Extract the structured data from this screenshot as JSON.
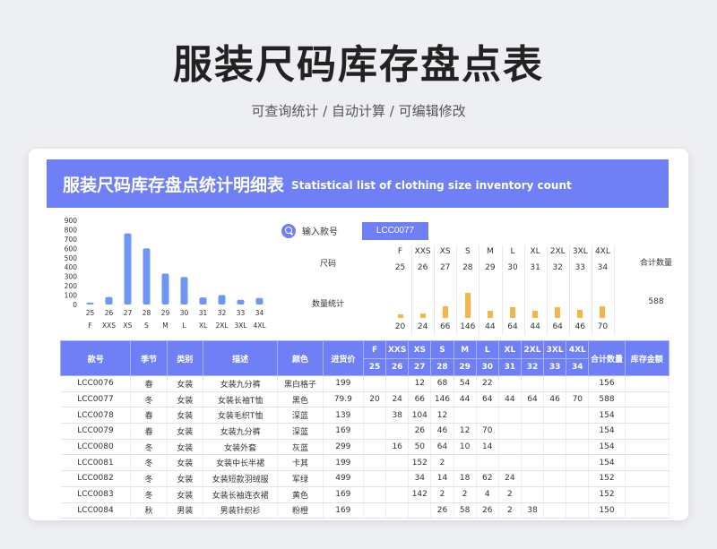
{
  "header": {
    "title": "服装尺码库存盘点表",
    "subtitle": "可查询统计 /  自动计算  /  可编辑修改"
  },
  "banner": {
    "title_cn": "服装尺码库存盘点统计明细表",
    "title_en": "Statistical list of clothing size inventory count"
  },
  "colors": {
    "accent": "#6f7ff5",
    "bar_blue": "#6f95f5",
    "bar_orange": "#f5b648"
  },
  "chart_data": {
    "type": "bar",
    "categories": [
      "F",
      "XXS",
      "XS",
      "S",
      "M",
      "L",
      "XL",
      "2XL",
      "3XL",
      "4XL"
    ],
    "x_numbers": [
      "25",
      "26",
      "27",
      "28",
      "29",
      "30",
      "31",
      "32",
      "33",
      "34"
    ],
    "values": [
      20,
      80,
      760,
      600,
      330,
      295,
      75,
      100,
      50,
      70
    ],
    "ylim": [
      0,
      900
    ],
    "yticks": [
      "900",
      "800",
      "700",
      "600",
      "500",
      "400",
      "300",
      "200",
      "100",
      "0"
    ],
    "grid": false,
    "legend": false
  },
  "search": {
    "label": "输入款号",
    "value": "LCC0077"
  },
  "summary": {
    "size_label": "尺码",
    "count_label": "数量统计",
    "total_label": "合计数量",
    "total_value": "588",
    "sizes": [
      "F",
      "XXS",
      "XS",
      "S",
      "M",
      "L",
      "XL",
      "2XL",
      "3XL",
      "4XL"
    ],
    "numbers": [
      "25",
      "26",
      "27",
      "28",
      "29",
      "30",
      "31",
      "32",
      "33",
      "34"
    ],
    "counts": [
      "20",
      "24",
      "66",
      "146",
      "44",
      "64",
      "44",
      "64",
      "46",
      "70"
    ],
    "count_values": [
      20,
      24,
      66,
      146,
      44,
      64,
      44,
      64,
      46,
      70
    ]
  },
  "table": {
    "headers": [
      "款号",
      "季节",
      "类别",
      "描述",
      "颜色",
      "进货价"
    ],
    "sizes": [
      "F",
      "XXS",
      "XS",
      "S",
      "M",
      "L",
      "XL",
      "2XL",
      "3XL",
      "4XL"
    ],
    "numbers": [
      "25",
      "26",
      "27",
      "28",
      "29",
      "30",
      "31",
      "32",
      "33",
      "34"
    ],
    "total_header": "合计数量",
    "amount_header": "库存金额",
    "rows": [
      {
        "id": "LCC0076",
        "season": "春",
        "category": "女装",
        "desc": "女装九分裤",
        "color": "黑白格子",
        "price": "199",
        "qty": [
          "",
          "",
          "12",
          "68",
          "54",
          "22",
          "",
          "",
          "",
          ""
        ],
        "total": "156",
        "amount": ""
      },
      {
        "id": "LCC0077",
        "season": "冬",
        "category": "女装",
        "desc": "女装长袖T恤",
        "color": "黑色",
        "price": "79.9",
        "qty": [
          "20",
          "24",
          "66",
          "146",
          "44",
          "64",
          "44",
          "64",
          "46",
          "70"
        ],
        "total": "588",
        "amount": ""
      },
      {
        "id": "LCC0078",
        "season": "春",
        "category": "女装",
        "desc": "女装毛织T恤",
        "color": "深蓝",
        "price": "139",
        "qty": [
          "",
          "38",
          "104",
          "12",
          "",
          "",
          "",
          "",
          "",
          ""
        ],
        "total": "154",
        "amount": ""
      },
      {
        "id": "LCC0079",
        "season": "春",
        "category": "女装",
        "desc": "女装九分裤",
        "color": "深蓝",
        "price": "169",
        "qty": [
          "",
          "",
          "26",
          "46",
          "12",
          "70",
          "",
          "",
          "",
          ""
        ],
        "total": "154",
        "amount": ""
      },
      {
        "id": "LCC0080",
        "season": "冬",
        "category": "女装",
        "desc": "女装外套",
        "color": "灰蓝",
        "price": "299",
        "qty": [
          "",
          "16",
          "50",
          "64",
          "10",
          "14",
          "",
          "",
          "",
          ""
        ],
        "total": "154",
        "amount": ""
      },
      {
        "id": "LCC0081",
        "season": "冬",
        "category": "女装",
        "desc": "女装中长半裙",
        "color": "卡其",
        "price": "199",
        "qty": [
          "",
          "",
          "152",
          "2",
          "",
          "",
          "",
          "",
          "",
          ""
        ],
        "total": "154",
        "amount": ""
      },
      {
        "id": "LCC0082",
        "season": "冬",
        "category": "女装",
        "desc": "女装短款羽绒服",
        "color": "军绿",
        "price": "499",
        "qty": [
          "",
          "",
          "34",
          "14",
          "18",
          "62",
          "24",
          "",
          "",
          ""
        ],
        "total": "152",
        "amount": ""
      },
      {
        "id": "LCC0083",
        "season": "冬",
        "category": "女装",
        "desc": "女装长袖连衣裙",
        "color": "黄色",
        "price": "169",
        "qty": [
          "",
          "",
          "142",
          "2",
          "2",
          "4",
          "2",
          "",
          "",
          ""
        ],
        "total": "152",
        "amount": ""
      },
      {
        "id": "LCC0084",
        "season": "秋",
        "category": "男装",
        "desc": "男装针织衫",
        "color": "粉橙",
        "price": "169",
        "qty": [
          "",
          "",
          "",
          "26",
          "58",
          "26",
          "2",
          "38",
          "",
          ""
        ],
        "total": "150",
        "amount": ""
      }
    ]
  }
}
